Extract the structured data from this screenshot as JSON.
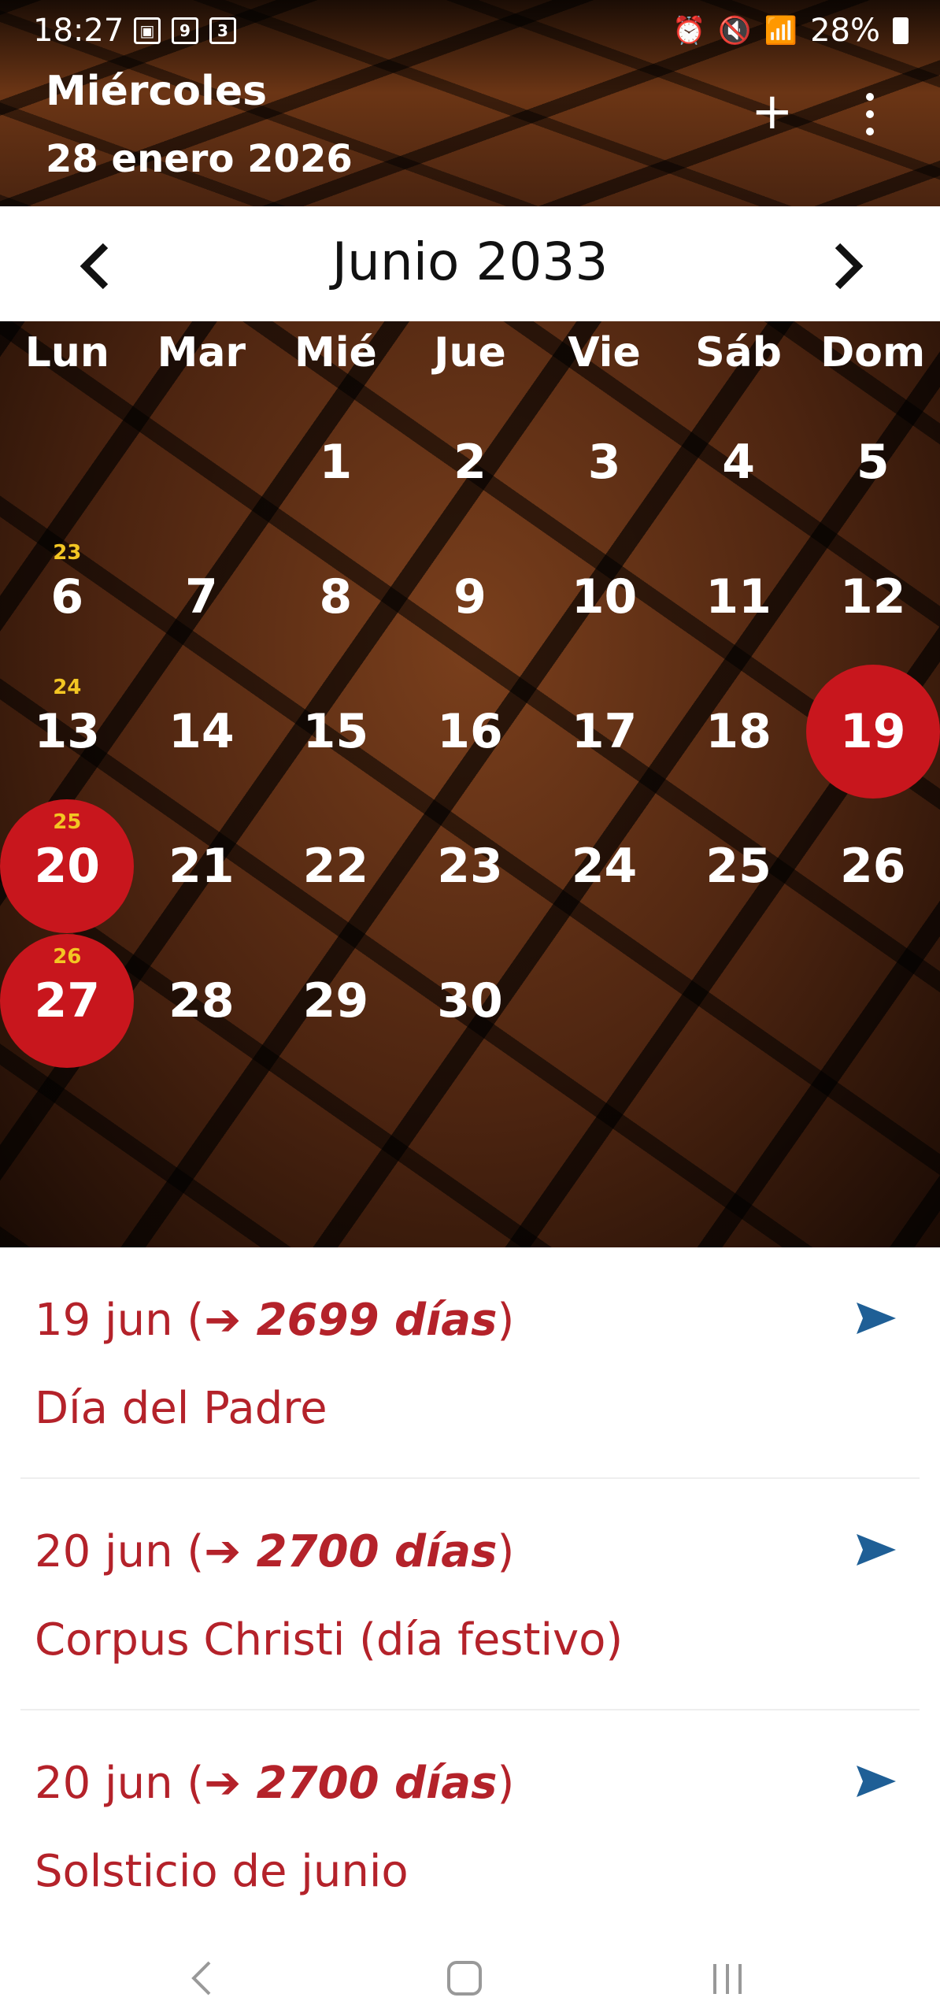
{
  "status": {
    "time": "18:27",
    "left_icons": [
      "image-icon",
      "9",
      "3"
    ],
    "right_text": "28%",
    "right_icons": [
      "alarm-icon",
      "mute-icon",
      "wifi-icon",
      "volte-icon",
      "signal-icon",
      "battery-icon"
    ]
  },
  "header": {
    "weekday": "Miércoles",
    "date": "28 enero 2026",
    "add_label": "+",
    "menu_icon": "more-vert-icon"
  },
  "calendar": {
    "month_title": "Junio 2033",
    "weekdays": [
      "Lun",
      "Mar",
      "Mié",
      "Jue",
      "Vie",
      "Sáb",
      "Dom"
    ],
    "rows": [
      {
        "week": "",
        "days": [
          "",
          "",
          "1",
          "2",
          "3",
          "4",
          "5"
        ]
      },
      {
        "week": "23",
        "days": [
          "6",
          "7",
          "8",
          "9",
          "10",
          "11",
          "12"
        ]
      },
      {
        "week": "24",
        "days": [
          "13",
          "14",
          "15",
          "16",
          "17",
          "18",
          "19"
        ]
      },
      {
        "week": "25",
        "days": [
          "20",
          "21",
          "22",
          "23",
          "24",
          "25",
          "26"
        ]
      },
      {
        "week": "26",
        "days": [
          "27",
          "28",
          "29",
          "30",
          "",
          "",
          ""
        ]
      }
    ],
    "highlighted_days": [
      "19",
      "20",
      "27"
    ],
    "highlight_color": "#c8161d",
    "week_number_color": "#f3c623"
  },
  "events": [
    {
      "date": "19 jun (",
      "arrow": "➔ 2699 días",
      "close": ")",
      "title": "Día del Padre"
    },
    {
      "date": "20 jun (",
      "arrow": "➔ 2700 días",
      "close": ")",
      "title": "Corpus Christi (día festivo)"
    },
    {
      "date": "20 jun (",
      "arrow": "➔ 2700 días",
      "close": ")",
      "title": "Solsticio de junio"
    }
  ],
  "colors": {
    "event_text": "#b4222a",
    "send_icon": "#1f5f96"
  },
  "navbar": [
    "back-icon",
    "home-icon",
    "recents-icon"
  ]
}
